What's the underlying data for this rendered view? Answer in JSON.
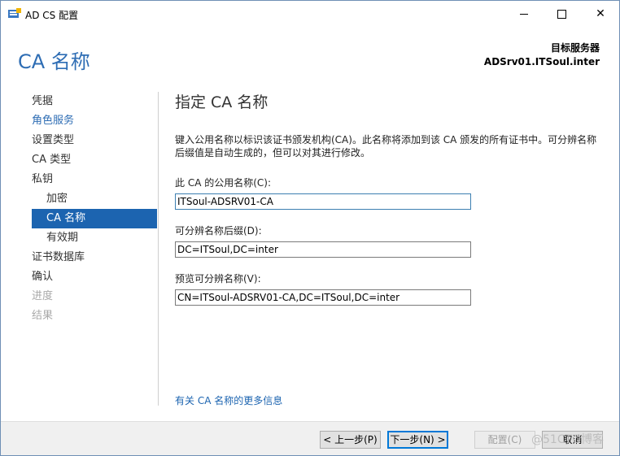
{
  "window": {
    "title": "AD CS 配置"
  },
  "header": {
    "title": "CA 名称",
    "target_label": "目标服务器",
    "target_server": "ADSrv01.ITSoul.inter"
  },
  "nav": {
    "items": [
      {
        "label": "凭据",
        "state": "normal"
      },
      {
        "label": "角色服务",
        "state": "link"
      },
      {
        "label": "设置类型",
        "state": "normal"
      },
      {
        "label": "CA 类型",
        "state": "normal"
      },
      {
        "label": "私钥",
        "state": "normal"
      },
      {
        "label": "加密",
        "state": "sub"
      },
      {
        "label": "CA 名称",
        "state": "active"
      },
      {
        "label": "有效期",
        "state": "sub"
      },
      {
        "label": "证书数据库",
        "state": "normal"
      },
      {
        "label": "确认",
        "state": "normal"
      },
      {
        "label": "进度",
        "state": "disabled"
      },
      {
        "label": "结果",
        "state": "disabled"
      }
    ]
  },
  "content": {
    "heading": "指定 CA 名称",
    "description": "键入公用名称以标识该证书颁发机构(CA)。此名称将添加到该 CA 颁发的所有证书中。可分辨名称后缀值是自动生成的，但可以对其进行修改。",
    "common_name_label": "此 CA 的公用名称(C):",
    "common_name_value": "ITSoul-ADSRV01-CA",
    "dn_suffix_label": "可分辨名称后缀(D):",
    "dn_suffix_value": "DC=ITSoul,DC=inter",
    "preview_label": "预览可分辨名称(V):",
    "preview_value": "CN=ITSoul-ADSRV01-CA,DC=ITSoul,DC=inter",
    "more_info_link": "有关 CA 名称的更多信息"
  },
  "footer": {
    "prev_label": "< 上一步(P)",
    "next_label": "下一步(N) >",
    "configure_label": "配置(C)",
    "cancel_label": "取消",
    "watermark": "@51CTO博客"
  },
  "colors": {
    "accent": "#2e6db4",
    "selection": "#1c64b0",
    "disabled": "#a9a9a9"
  }
}
